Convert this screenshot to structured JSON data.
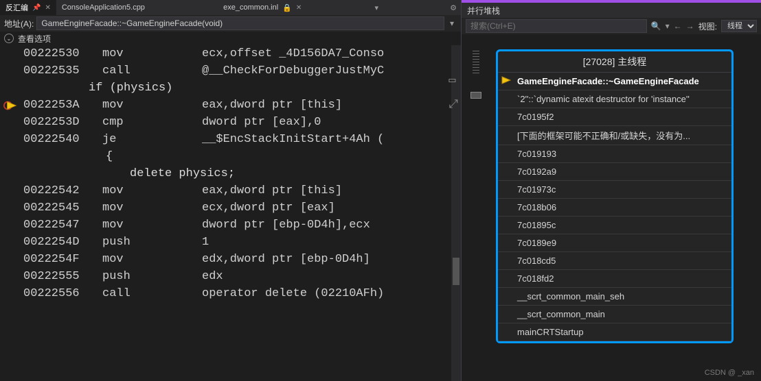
{
  "tabs": {
    "disasm": "反汇编",
    "file1": "ConsoleApplication5.cpp",
    "file2": "exe_common.inl"
  },
  "addr": {
    "label": "地址(A):",
    "value": "GameEngineFacade::~GameEngineFacade(void)"
  },
  "options_label": "查看选项",
  "disasm_lines": [
    {
      "addr": "00222530",
      "mnem": "mov",
      "ops": "ecx,offset _4D156DA7_Conso"
    },
    {
      "addr": "00222535",
      "mnem": "call",
      "ops": "@__CheckForDebuggerJustMyC"
    },
    {
      "src": "if (physics)"
    },
    {
      "addr": "0022253A",
      "mnem": "mov",
      "ops": "eax,dword ptr [this]",
      "marker": true
    },
    {
      "addr": "0022253D",
      "mnem": "cmp",
      "ops": "dword ptr [eax],0"
    },
    {
      "addr": "00222540",
      "mnem": "je",
      "ops": "__$EncStackInitStart+4Ah ("
    },
    {
      "brace": "{"
    },
    {
      "src2": "delete physics;"
    },
    {
      "addr": "00222542",
      "mnem": "mov",
      "ops": "eax,dword ptr [this]"
    },
    {
      "addr": "00222545",
      "mnem": "mov",
      "ops": "ecx,dword ptr [eax]"
    },
    {
      "addr": "00222547",
      "mnem": "mov",
      "ops": "dword ptr [ebp-0D4h],ecx"
    },
    {
      "addr": "0022254D",
      "mnem": "push",
      "ops": "1"
    },
    {
      "addr": "0022254F",
      "mnem": "mov",
      "ops": "edx,dword ptr [ebp-0D4h]"
    },
    {
      "addr": "00222555",
      "mnem": "push",
      "ops": "edx"
    },
    {
      "addr": "00222556",
      "mnem": "call",
      "ops": "operator delete (02210AFh)"
    }
  ],
  "right": {
    "title": "并行堆栈",
    "search_placeholder": "搜索(Ctrl+E)",
    "view_label": "视图:",
    "view_value": "线程"
  },
  "stack": {
    "thread": "[27028] 主线程",
    "frames": [
      {
        "t": "GameEngineFacade::~GameEngineFacade",
        "active": true
      },
      {
        "t": "`2''::`dynamic atexit destructor for 'instance''"
      },
      {
        "t": "7c0195f2"
      },
      {
        "t": "[下面的框架可能不正确和/或缺失，没有为..."
      },
      {
        "t": "7c019193"
      },
      {
        "t": "7c0192a9"
      },
      {
        "t": "7c01973c"
      },
      {
        "t": "7c018b06"
      },
      {
        "t": "7c01895c"
      },
      {
        "t": "7c0189e9"
      },
      {
        "t": "7c018cd5"
      },
      {
        "t": "7c018fd2"
      },
      {
        "t": "__scrt_common_main_seh"
      },
      {
        "t": "__scrt_common_main"
      },
      {
        "t": "mainCRTStartup"
      }
    ]
  },
  "watermark": "CSDN @ _xan"
}
